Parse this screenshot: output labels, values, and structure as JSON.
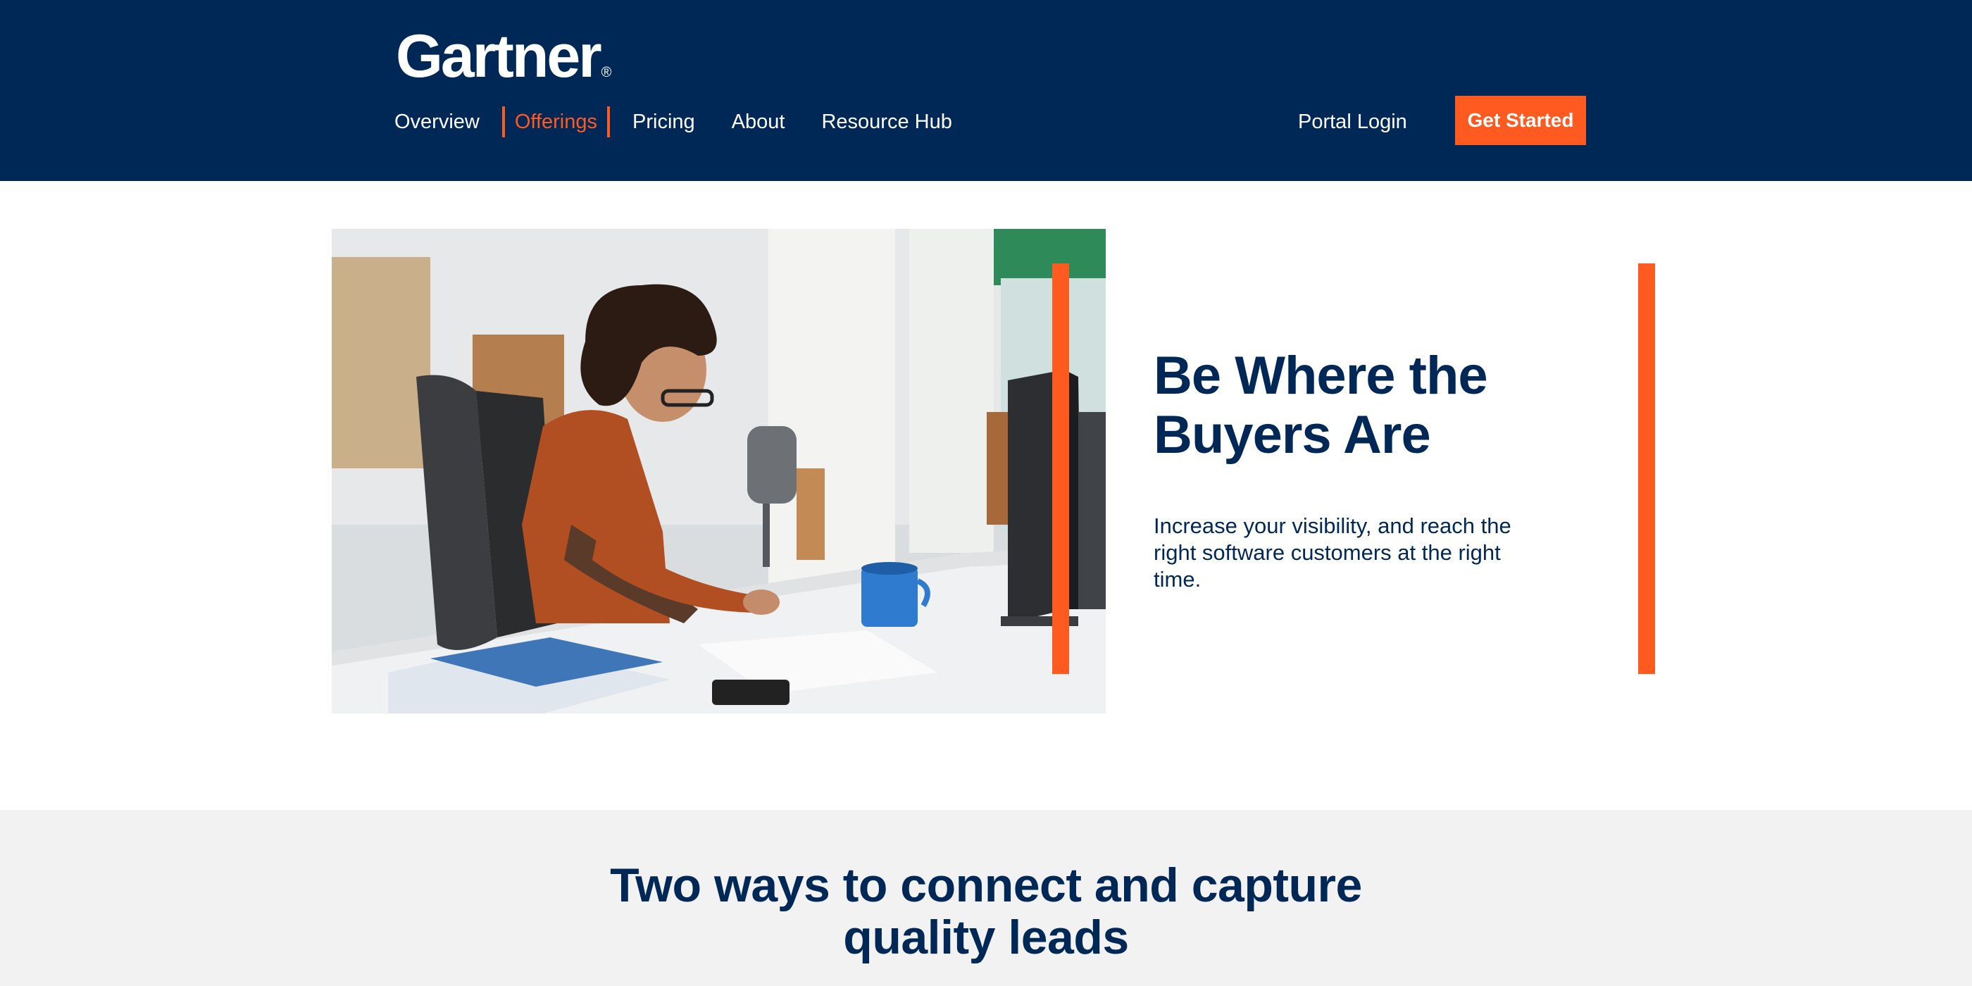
{
  "header": {
    "logo_text": "Gartner",
    "logo_mark": "®",
    "nav": [
      {
        "label": "Overview",
        "active": false
      },
      {
        "label": "Offerings",
        "active": true
      },
      {
        "label": "Pricing",
        "active": false
      },
      {
        "label": "About",
        "active": false
      },
      {
        "label": "Resource Hub",
        "active": false
      }
    ],
    "portal_login": "Portal Login",
    "cta": "Get Started"
  },
  "hero": {
    "title": "Be Where the Buyers Are",
    "description": "Increase your visibility, and reach the right software customers at the right time.",
    "image_icon": "office-photo"
  },
  "section_two": {
    "title_line1": "Two ways to connect and capture",
    "title_line2": "quality leads"
  },
  "colors": {
    "header_bg": "#002856",
    "accent": "#ff5a1f",
    "text_dark": "#002856",
    "section_bg": "#f2f2f2"
  }
}
